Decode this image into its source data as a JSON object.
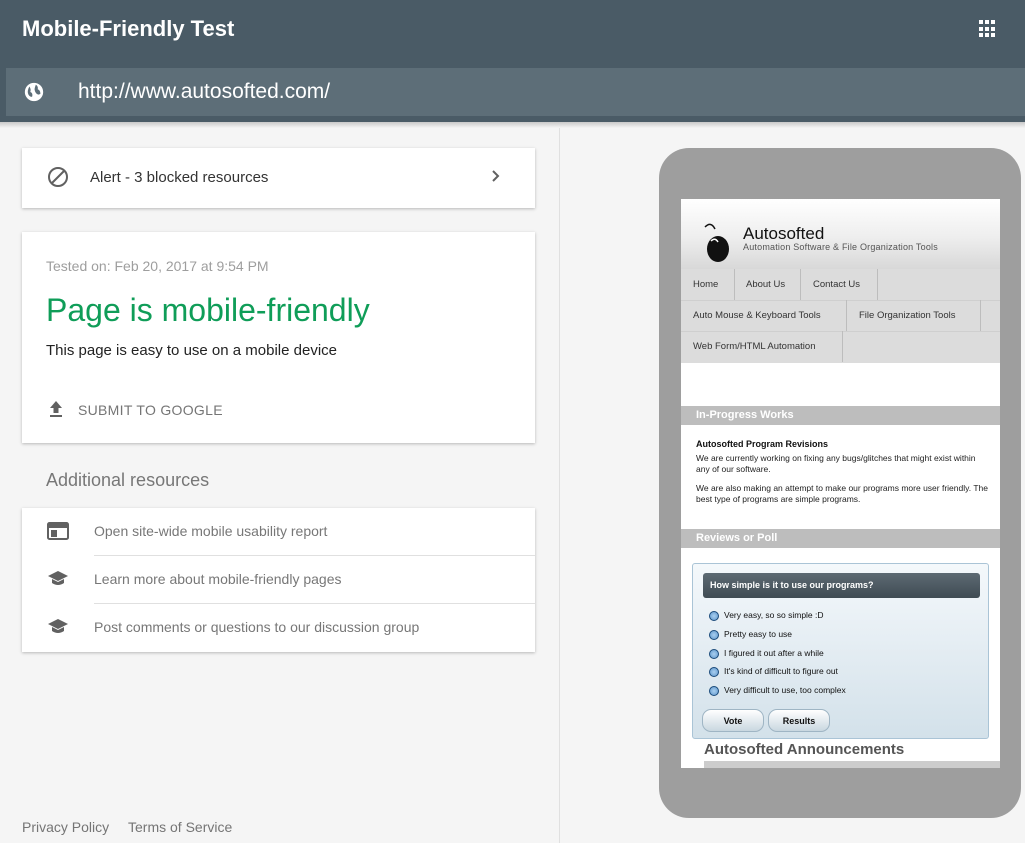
{
  "header": {
    "app_title": "Mobile-Friendly Test",
    "url": "http://www.autosofted.com/"
  },
  "alert": {
    "label": "Alert - 3 blocked resources"
  },
  "result": {
    "tested_on": "Tested on: Feb 20, 2017 at 9:54 PM",
    "title": "Page is mobile-friendly",
    "subtitle": "This page is easy to use on a mobile device",
    "submit_label": "SUBMIT TO GOOGLE"
  },
  "resources": {
    "title": "Additional resources",
    "items": [
      {
        "label": "Open site-wide mobile usability report",
        "icon": "browser-window-icon"
      },
      {
        "label": "Learn more about mobile-friendly pages",
        "icon": "school-icon"
      },
      {
        "label": "Post comments or questions to our discussion group",
        "icon": "school-icon"
      }
    ]
  },
  "footer": {
    "privacy": "Privacy Policy",
    "terms": "Terms of Service"
  },
  "preview": {
    "site_name": "Autosofted",
    "tagline": "Automation Software & File Organization Tools",
    "nav": [
      "Home",
      "About Us",
      "Contact Us",
      "Auto Mouse & Keyboard Tools",
      "File Organization Tools",
      "Web Form/HTML Automation"
    ],
    "in_progress": {
      "bar": "In-Progress Works",
      "heading": "Autosofted Program Revisions",
      "p1": "We are currently working on fixing any bugs/glitches that might exist within any of our software.",
      "p2": "We are also making an attempt to make our programs more user friendly. The best type of programs are simple programs."
    },
    "reviews_bar": "Reviews or Poll",
    "poll": {
      "question": "How simple is it to use our programs?",
      "options": [
        "Very easy, so so simple :D",
        "Pretty easy to use",
        "I figured it out after a while",
        "It's kind of difficult to figure out",
        "Very difficult to use, too complex"
      ],
      "vote": "Vote",
      "results": "Results"
    },
    "announcements": "Autosofted Announcements"
  },
  "colors": {
    "header_bg": "#4a5b66",
    "urlbar_bg": "#5d6e78",
    "success_green": "#0f9d58",
    "phone_frame": "#9e9e9e"
  }
}
